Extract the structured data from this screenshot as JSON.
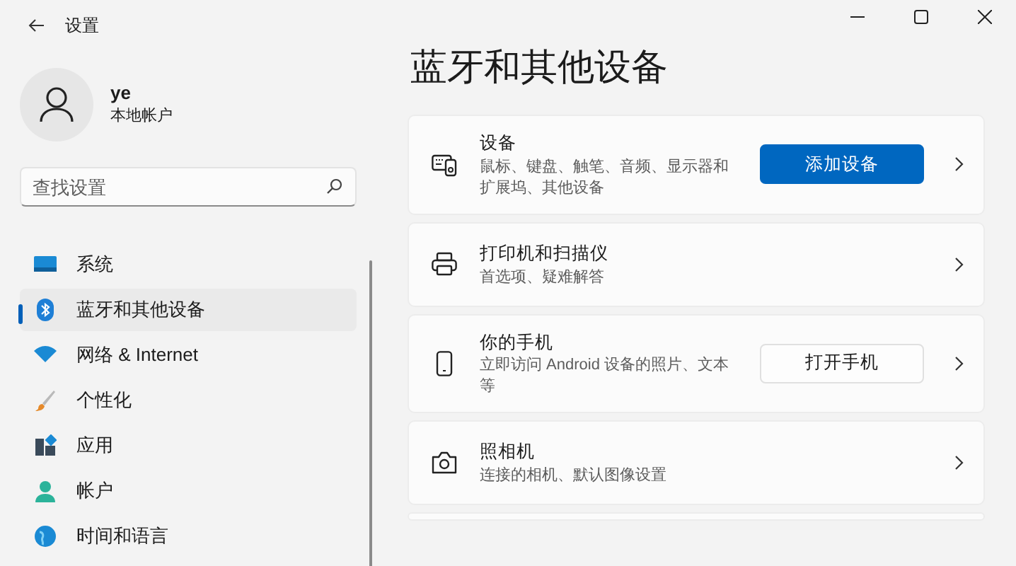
{
  "window": {
    "title": "设置"
  },
  "user": {
    "name": "ye",
    "account_type": "本地帐户"
  },
  "search": {
    "placeholder": "查找设置"
  },
  "nav": [
    {
      "kind": "system",
      "label": "系统",
      "selected": false
    },
    {
      "kind": "bluetooth",
      "label": "蓝牙和其他设备",
      "selected": true
    },
    {
      "kind": "network",
      "label": "网络 & Internet",
      "selected": false
    },
    {
      "kind": "personalization",
      "label": "个性化",
      "selected": false
    },
    {
      "kind": "apps",
      "label": "应用",
      "selected": false
    },
    {
      "kind": "accounts",
      "label": "帐户",
      "selected": false
    },
    {
      "kind": "time",
      "label": "时间和语言",
      "selected": false
    }
  ],
  "page": {
    "title": "蓝牙和其他设备",
    "cards": [
      {
        "kind": "devices",
        "title": "设备",
        "description": "鼠标、键盘、触笔、音频、显示器和扩展坞、其他设备",
        "button": {
          "label": "添加设备",
          "primary": true
        }
      },
      {
        "kind": "printers",
        "title": "打印机和扫描仪",
        "description": "首选项、疑难解答"
      },
      {
        "kind": "phone",
        "title": "你的手机",
        "description": "立即访问 Android 设备的照片、文本等",
        "button": {
          "label": "打开手机",
          "primary": false
        }
      },
      {
        "kind": "camera",
        "title": "照相机",
        "description": "连接的相机、默认图像设置"
      },
      {
        "kind": "blank"
      }
    ]
  }
}
